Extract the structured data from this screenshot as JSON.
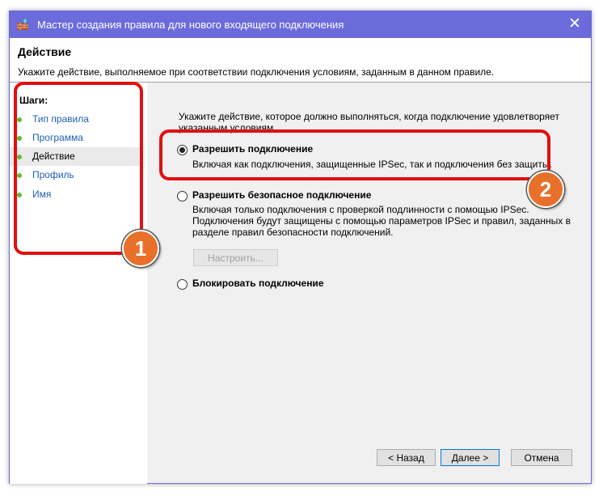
{
  "window": {
    "title": "Мастер создания правила для нового входящего подключения",
    "icon": "firewall-icon",
    "close_glyph": "✕"
  },
  "header": {
    "title": "Действие",
    "subtitle": "Укажите действие, выполняемое при соответствии подключения условиям, заданным в данном правиле."
  },
  "sidebar": {
    "label": "Шаги:",
    "items": [
      {
        "label": "Тип правила",
        "active": false
      },
      {
        "label": "Программа",
        "active": false
      },
      {
        "label": "Действие",
        "active": true
      },
      {
        "label": "Профиль",
        "active": false
      },
      {
        "label": "Имя",
        "active": false
      }
    ]
  },
  "main": {
    "prompt_line1": "Укажите действие, которое должно выполняться, когда подключение удовлетворяет",
    "prompt_line2": "указанным условиям.",
    "options": [
      {
        "label": "Разрешить подключение",
        "checked": true,
        "desc": [
          "Включая как подключения, защищенные IPSec, так и подключения без защиты."
        ]
      },
      {
        "label": "Разрешить безопасное подключение",
        "checked": false,
        "desc": [
          "Включая только подключения с проверкой подлинности с помощью IPSec.",
          "Подключения будут защищены с помощью параметров IPSec и правил, заданных в",
          "разделе правил безопасности подключений."
        ]
      },
      {
        "label": "Блокировать подключение",
        "checked": false,
        "desc": []
      }
    ],
    "customize_label": "Настроить..."
  },
  "buttons": {
    "back": "< Назад",
    "next": "Далее >",
    "cancel": "Отмена"
  },
  "annotations": {
    "badge1": "1",
    "badge2": "2",
    "highlight_color": "#e01010",
    "badge_color": "#e8702a"
  },
  "colors": {
    "titlebar": "#6b6bdc",
    "link": "#1f5fb8",
    "step_dot": "#5cbf2a"
  }
}
